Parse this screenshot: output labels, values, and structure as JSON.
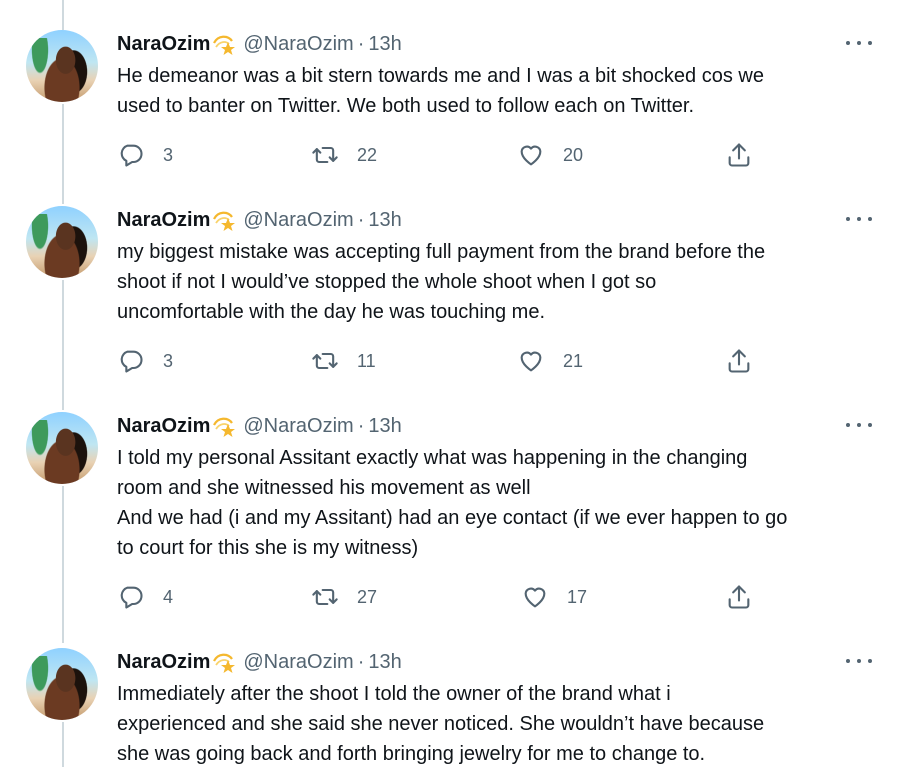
{
  "tweets": [
    {
      "name": "NaraOzim",
      "handle": "@NaraOzim",
      "time": "13h",
      "lines": [
        "He demeanor was a bit stern towards me and I was a bit shocked cos we",
        "used to banter on Twitter. We both used to follow each on Twitter."
      ],
      "replies": "3",
      "retweets": "22",
      "likes": "20"
    },
    {
      "name": "NaraOzim",
      "handle": "@NaraOzim",
      "time": "13h",
      "lines": [
        "my biggest mistake was accepting full payment from the brand before the",
        "shoot if not I would’ve stopped the whole shoot when I got so",
        "uncomfortable with the day he was touching me."
      ],
      "replies": "3",
      "retweets": "11",
      "likes": "21"
    },
    {
      "name": "NaraOzim",
      "handle": "@NaraOzim",
      "time": "13h",
      "lines": [
        "I told my personal Assitant exactly what was happening in the changing",
        "room and she witnessed his movement as well",
        "And we had (i and my Assitant) had an eye contact (if we ever happen to go",
        "to court for this she is my witness)"
      ],
      "replies": "4",
      "retweets": "27",
      "likes": "17"
    },
    {
      "name": "NaraOzim",
      "handle": "@NaraOzim",
      "time": "13h",
      "lines": [
        "Immediately after the shoot I told the owner of the brand what i",
        "experienced and she said she never noticed. She wouldn’t have because",
        "she was going back and forth bringing jewelry for me to change to."
      ]
    }
  ],
  "separator": "·",
  "icons": {
    "badge": "shooting-star-emoji",
    "more": "more-options-icon",
    "reply": "reply-icon",
    "retweet": "retweet-icon",
    "like": "heart-icon",
    "share": "share-icon"
  },
  "colors": {
    "text": "#0f1419",
    "secondary": "#536471",
    "thread_line": "#cfd9de",
    "background": "#ffffff"
  }
}
